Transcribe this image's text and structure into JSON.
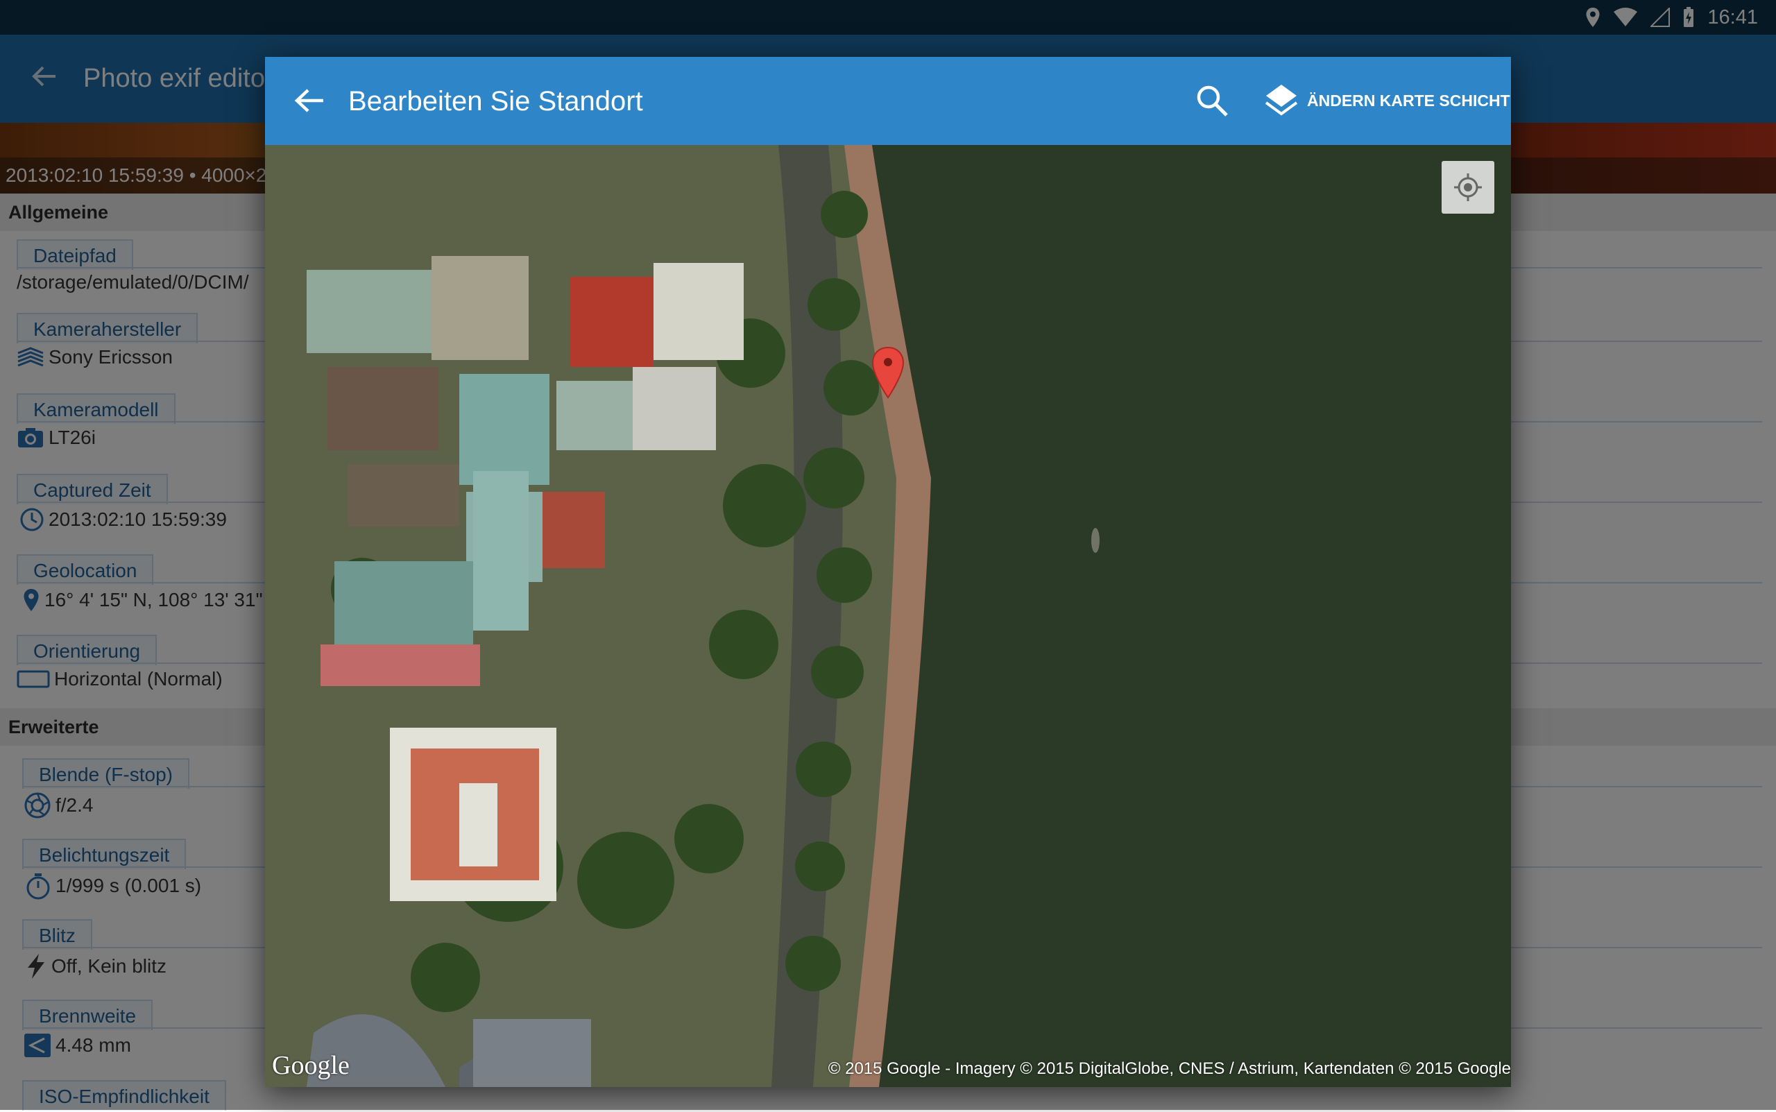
{
  "status_bar": {
    "time": "16:41"
  },
  "app": {
    "title": "Photo exif editor"
  },
  "photo_info": "2013:02:10 15:59:39 • 4000×2",
  "sections": {
    "general": "Allgemeine",
    "advanced": "Erweiterte"
  },
  "fields": [
    {
      "label": "Dateipfad",
      "value": "/storage/emulated/0/DCIM/",
      "icon": "file-icon"
    },
    {
      "label": "Kamerahersteller",
      "value": "Sony Ericsson",
      "icon": "maker-logo-icon"
    },
    {
      "label": "Kameramodell",
      "value": "LT26i",
      "icon": "camera-icon"
    },
    {
      "label": "Captured Zeit",
      "value": "2013:02:10 15:59:39",
      "icon": "clock-icon"
    },
    {
      "label": "Geolocation",
      "value": "16° 4' 15\" N, 108° 13' 31\"",
      "icon": "location-icon"
    },
    {
      "label": "Orientierung",
      "value": "Horizontal (Normal)",
      "icon": "orientation-icon"
    },
    {
      "label": "Blende (F-stop)",
      "value": "f/2.4",
      "icon": "aperture-icon"
    },
    {
      "label": "Belichtungszeit",
      "value": "1/999 s (0.001 s)",
      "icon": "timer-icon"
    },
    {
      "label": "Blitz",
      "value": "Off, Kein blitz",
      "icon": "flash-icon"
    },
    {
      "label": "Brennweite",
      "value": "4.48 mm",
      "icon": "focal-length-icon"
    },
    {
      "label": "ISO-Empfindlichkeit",
      "value": "",
      "icon": "iso-icon"
    }
  ],
  "dialog": {
    "title": "Bearbeiten Sie Standort",
    "layers_label": "ÄNDERN KARTE SCHICHT"
  },
  "map": {
    "logo": "Google",
    "attribution": "© 2015 Google - Imagery © 2015 DigitalGlobe, CNES / Astrium, Kartendaten © 2015 Google",
    "marker_color": "#e8453c"
  },
  "colors": {
    "status_bar": "#0d3047",
    "app_toolbar": "#1f6da8",
    "dialog_toolbar": "#2e86c8"
  }
}
